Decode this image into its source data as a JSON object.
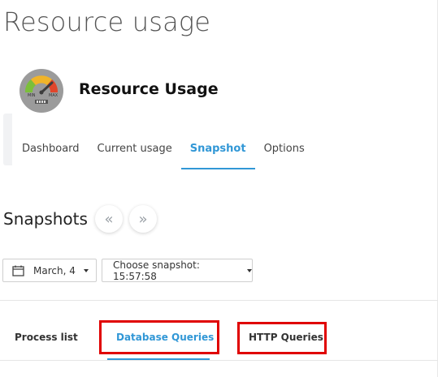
{
  "page": {
    "title": "Resource usage"
  },
  "app": {
    "name": "Resource Usage",
    "icon": "speedometer-gauge-icon",
    "gauge_min_label": "MIN",
    "gauge_max_label": "MAX"
  },
  "nav": {
    "tabs": [
      {
        "label": "Dashboard",
        "active": false
      },
      {
        "label": "Current usage",
        "active": false
      },
      {
        "label": "Snapshot",
        "active": true
      },
      {
        "label": "Options",
        "active": false
      }
    ]
  },
  "snapshots": {
    "title": "Snapshots",
    "prev_glyph": "«",
    "next_glyph": "»",
    "date_dropdown": {
      "value": "March, 4",
      "icon": "calendar-icon"
    },
    "snapshot_dropdown": {
      "value": "Choose snapshot: 15:57:58"
    }
  },
  "subtabs": [
    {
      "label": "Process list",
      "active": false
    },
    {
      "label": "Database Queries",
      "active": true,
      "highlighted": true
    },
    {
      "label": "HTTP Queries",
      "active": false,
      "highlighted": true
    }
  ],
  "colors": {
    "accent": "#3197d6",
    "highlight": "#e00000",
    "text": "#222222",
    "muted": "#555555"
  }
}
